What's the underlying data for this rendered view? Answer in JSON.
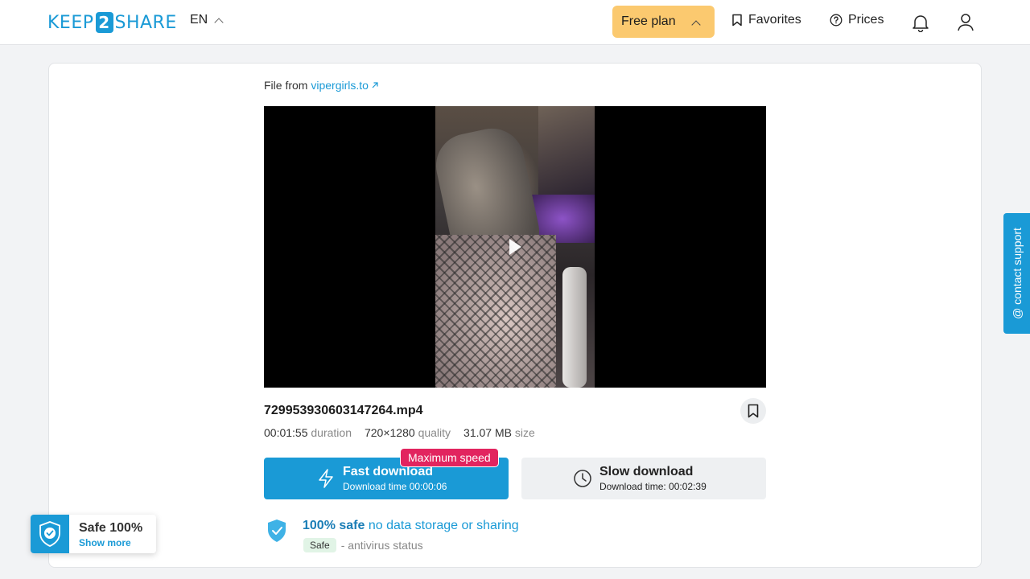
{
  "header": {
    "logo": {
      "left": "KEEP",
      "middle": "2",
      "right": "SHARE"
    },
    "language": "EN",
    "plan_label": "Free plan",
    "favorites_label": "Favorites",
    "prices_label": "Prices"
  },
  "file": {
    "from_prefix": "File from",
    "source_link": "vipergirls.to",
    "name": "729953930603147264.mp4",
    "duration": "00:01:55",
    "duration_label": "duration",
    "quality": "720×1280",
    "quality_label": "quality",
    "size": "31.07 MB",
    "size_label": "size"
  },
  "downloads": {
    "max_speed_badge": "Maximum speed",
    "fast_title": "Fast download",
    "fast_subtitle": "Download time 00:00:06",
    "slow_title": "Slow download",
    "slow_subtitle": "Download time: 00:02:39"
  },
  "safety": {
    "headline_bold": "100% safe",
    "headline_rest": "no data storage or sharing",
    "badge": "Safe",
    "status_text": "- antivirus status"
  },
  "safe_widget": {
    "title": "Safe 100%",
    "link": "Show more"
  },
  "support_tab": "@ contact support",
  "colors": {
    "brand_blue": "#1a9ad6",
    "plan_yellow": "#fbc96f",
    "badge_red": "#e2245f"
  },
  "icons": [
    "bookmark-icon",
    "help-circle-icon",
    "bell-icon",
    "user-icon",
    "external-link-icon",
    "play-icon",
    "lightning-icon",
    "clock-icon",
    "shield-check-icon"
  ]
}
